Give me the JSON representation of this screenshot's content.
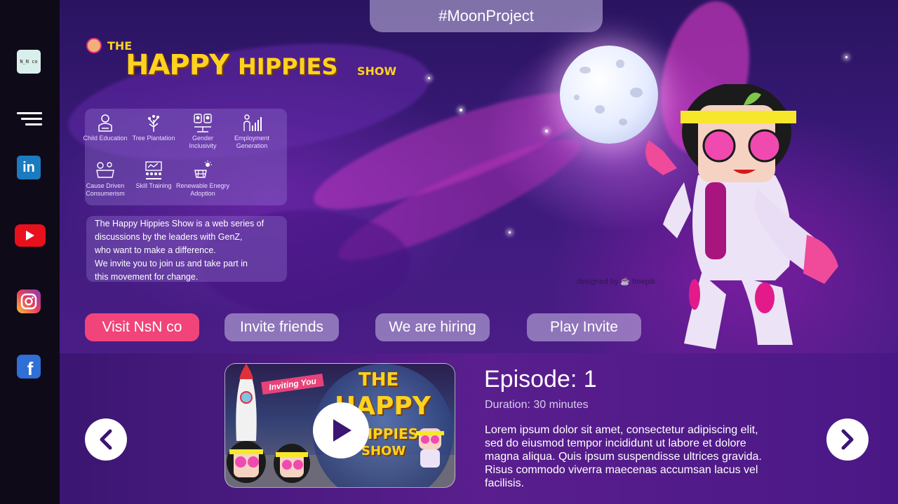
{
  "sidebar": {
    "logo_text": "N_N co",
    "items": [
      {
        "name": "nsn-logo"
      },
      {
        "name": "menu"
      },
      {
        "name": "linkedin",
        "label": "in"
      },
      {
        "name": "youtube"
      },
      {
        "name": "instagram"
      },
      {
        "name": "facebook",
        "label": "f"
      }
    ]
  },
  "hero": {
    "hashtag": "#MoonProject",
    "brand": {
      "the": "THE",
      "happy": "HAPPY",
      "hippies": "HIPPIES",
      "show": "SHOW"
    },
    "causes": [
      {
        "label": "Child Education",
        "icon": "child-education-icon"
      },
      {
        "label": "Tree Plantation",
        "icon": "tree-icon"
      },
      {
        "label": "Gender Inclusivity",
        "icon": "gender-icon"
      },
      {
        "label": "Employment Generation",
        "icon": "employment-icon"
      },
      {
        "label": "Cause Driven Consumerism",
        "icon": "consumerism-icon"
      },
      {
        "label": "Skill Training",
        "icon": "skill-training-icon"
      },
      {
        "label": "Renewable Enegry Adoption",
        "icon": "renewable-energy-icon"
      }
    ],
    "description_lines": [
      "The Happy Hippies Show is a web series of",
      "discussions by the leaders with GenZ,",
      "who want to make a difference.",
      "We invite you to join us and take part in",
      "this movement for change."
    ],
    "credit": "designed by ☕ freepik",
    "buttons": {
      "visit": "Visit NsN co",
      "invite": "Invite friends",
      "hiring": "We are hiring",
      "play_invite": "Play Invite"
    }
  },
  "episode": {
    "thumbnail_text": {
      "banner": "Inviting You",
      "the": "THE",
      "happy": "HAPPY",
      "hippies": "HIPPIES",
      "show": "SHOW"
    },
    "title": "Episode: 1",
    "duration": "Duration: 30 minutes",
    "description": "Lorem ipsum dolor sit amet, consectetur adipiscing elit, sed do eiusmod tempor incididunt ut labore et dolore magna aliqua. Quis ipsum suspendisse ultrices gravida. Risus commodo viverra maecenas accumsan lacus vel facilisis."
  },
  "colors": {
    "accent_pink": "#f0447a",
    "brand_yellow": "#ffd21e",
    "sidebar_bg": "#0f0a18"
  }
}
